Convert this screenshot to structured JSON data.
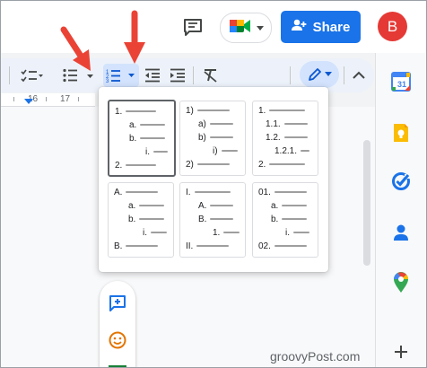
{
  "topbar": {
    "share_label": "Share",
    "avatar_initial": "B",
    "comment_icon": "comment-history-icon",
    "meet_icon": "google-meet-icon",
    "share_icon": "person-add-icon"
  },
  "toolbar": {
    "tools": [
      "checklist",
      "bulleted-list",
      "numbered-list",
      "decrease-indent",
      "increase-indent",
      "clear-formatting",
      "editing-mode",
      "collapse-menus"
    ]
  },
  "ruler": {
    "labels": [
      "16",
      "17"
    ]
  },
  "numbered_list_menu": {
    "options": [
      {
        "lines": [
          "1.",
          "a.",
          "b.",
          "i.",
          "2."
        ],
        "selected": true
      },
      {
        "lines": [
          "1)",
          "a)",
          "b)",
          "i)",
          "2)"
        ],
        "selected": false
      },
      {
        "lines": [
          "1.",
          "1.1.",
          "1.2.",
          "1.2.1.",
          "2."
        ],
        "selected": false
      },
      {
        "lines": [
          "A.",
          "a.",
          "b.",
          "i.",
          "B."
        ],
        "selected": false
      },
      {
        "lines": [
          "I.",
          "A.",
          "B.",
          "1.",
          "II."
        ],
        "selected": false
      },
      {
        "lines": [
          "01.",
          "a.",
          "b.",
          "i.",
          "02."
        ],
        "selected": false
      }
    ]
  },
  "side_panel": {
    "apps": [
      "calendar-icon",
      "keep-icon",
      "tasks-icon",
      "contacts-icon",
      "maps-icon",
      "add-icon"
    ]
  },
  "floating_bar": {
    "items": [
      "add-comment-icon",
      "emoji-icon"
    ]
  },
  "watermark": "groovyPost.com",
  "colors": {
    "accent": "#1a73e8",
    "arrow": "#ea4335",
    "avatar": "#e53935"
  }
}
